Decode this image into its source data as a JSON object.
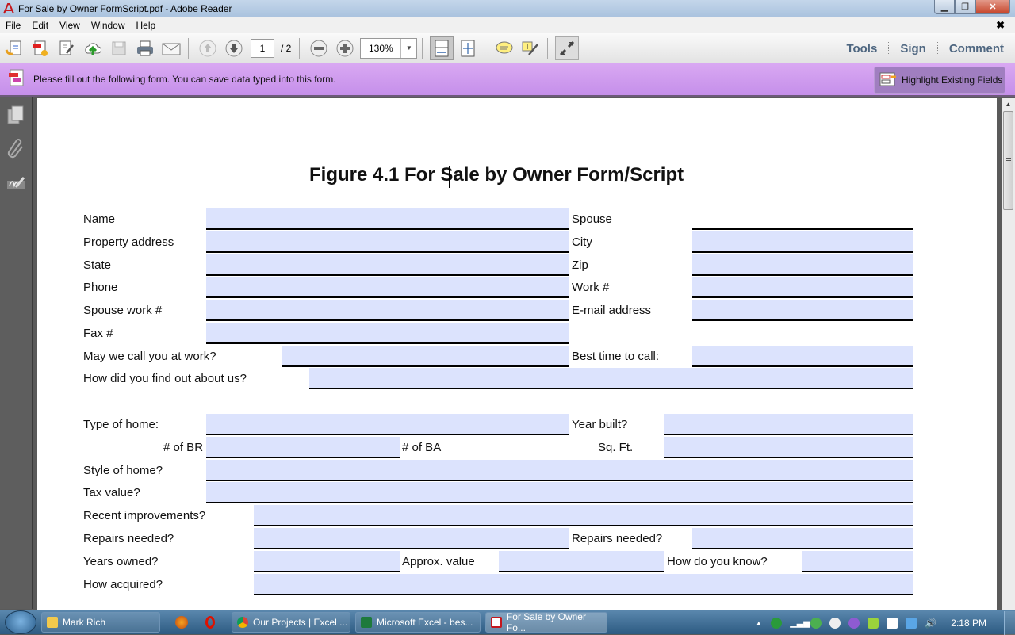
{
  "window": {
    "title": "For Sale by Owner FormScript.pdf - Adobe Reader"
  },
  "menu": [
    "File",
    "Edit",
    "View",
    "Window",
    "Help"
  ],
  "toolbar": {
    "page_current": "1",
    "page_total": "/ 2",
    "zoom": "130%",
    "links": [
      "Tools",
      "Sign",
      "Comment"
    ]
  },
  "formbar": {
    "message": "Please fill out the following form. You can save data typed into this form.",
    "highlight_button": "Highlight Existing Fields"
  },
  "document": {
    "title": "Figure 4.1 For Sale by Owner Form/Script",
    "labels": {
      "name": "Name",
      "spouse": "Spouse",
      "property_address": "Property address",
      "city": "City",
      "state": "State",
      "zip": "Zip",
      "phone": "Phone",
      "work": "Work #",
      "spouse_work": "Spouse work #",
      "email": "E-mail address",
      "fax": "Fax #",
      "call_at_work": "May we call you at work?",
      "best_time": "Best time to call:",
      "find_out": "How did you find out about us?",
      "type_of_home": "Type of home:",
      "year_built": "Year built?",
      "br": "# of BR",
      "ba": "# of BA",
      "sqft": "Sq. Ft.",
      "style": "Style of home?",
      "tax": "Tax value?",
      "improvements": "Recent improvements?",
      "repairs1": "Repairs needed?",
      "repairs2": "Repairs needed?",
      "years_owned": "Years owned?",
      "approx_value": "Approx. value",
      "how_know": "How do you know?",
      "how_acquired": "How acquired?"
    },
    "fields": {
      "name": "",
      "spouse": "",
      "property_address": "",
      "city": "",
      "state": "",
      "zip": "",
      "phone": "",
      "work": "",
      "spouse_work": "",
      "email": "",
      "fax": "",
      "call_at_work": "",
      "best_time": "",
      "find_out": "",
      "type_of_home": "",
      "year_built": "",
      "br": "",
      "ba": "",
      "sqft": "",
      "style": "",
      "tax": "",
      "improvements": "",
      "repairs1": "",
      "repairs2": "",
      "years_owned": "",
      "approx_value": "",
      "how_know": "",
      "how_acquired": ""
    }
  },
  "taskbar": {
    "items": [
      "Mark Rich",
      "Our Projects | Excel ...",
      "Microsoft Excel - bes...",
      "For Sale by Owner Fo..."
    ],
    "clock": "2:18 PM"
  },
  "colors": {
    "field_fill": "#dce3fd",
    "formbar": "#c58fea",
    "link": "#4f6781"
  }
}
